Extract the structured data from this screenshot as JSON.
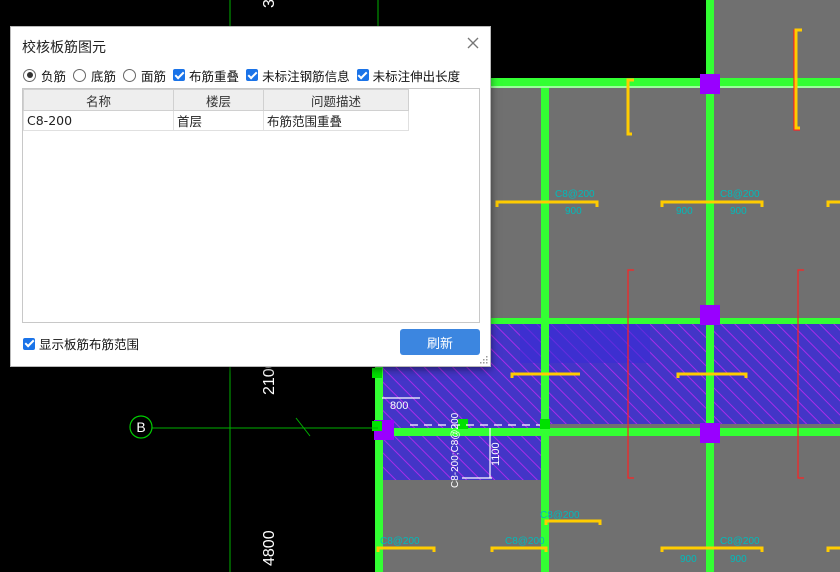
{
  "dialog": {
    "title": "校核板筋图元",
    "close_icon": "close-icon",
    "radios": [
      {
        "label": "负筋",
        "checked": true
      },
      {
        "label": "底筋",
        "checked": false
      },
      {
        "label": "面筋",
        "checked": false
      }
    ],
    "checkboxes": [
      {
        "label": "布筋重叠",
        "checked": true
      },
      {
        "label": "未标注钢筋信息",
        "checked": true
      },
      {
        "label": "未标注伸出长度",
        "checked": true
      }
    ],
    "table": {
      "headers": [
        "名称",
        "楼层",
        "问题描述"
      ],
      "rows": [
        [
          "C8-200",
          "首层",
          "布筋范围重叠"
        ]
      ]
    },
    "show_range_label": "显示板筋布筋范围",
    "show_range_checked": true,
    "refresh_label": "刷新"
  },
  "drawing": {
    "dim_top": "3",
    "dim_2100": "2100",
    "dim_4800": "4800",
    "axis_b": "B",
    "dim_800": "800",
    "dim_1100": "1100",
    "rebar_label": "C8-200;C8@200",
    "colors": {
      "background": "#000000",
      "slab": "#707070",
      "beam": "#33ff33",
      "column": "#9900ff",
      "rebar": "#ffcc00",
      "hatch": "#3b2bd6",
      "dim_red": "#ff2222",
      "text_cyan": "#00cccc",
      "axis": "#00cc00"
    }
  }
}
